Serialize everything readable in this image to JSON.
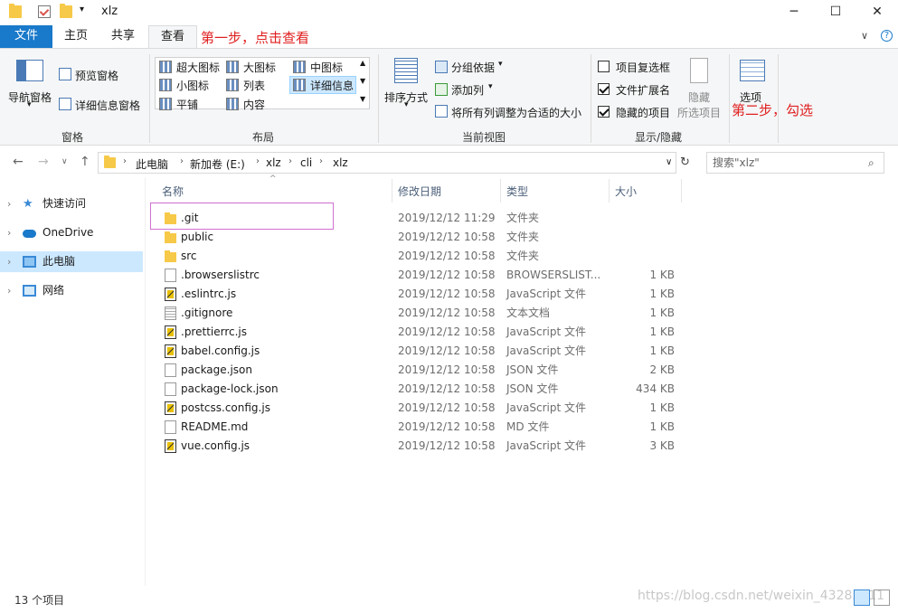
{
  "window": {
    "title": "xlz",
    "minimize": "─",
    "maximize": "☐",
    "close": "✕"
  },
  "tabs": {
    "file": "文件",
    "home": "主页",
    "share": "共享",
    "view": "查看",
    "collapse": "∨",
    "help": "?"
  },
  "annotations": {
    "step1": "第一步，点击查看",
    "step2": "第二步，勾选"
  },
  "ribbon": {
    "panes": {
      "nav_pane": "导航窗格",
      "preview": "预览窗格",
      "details": "详细信息窗格",
      "label": "窗格"
    },
    "layout": {
      "xl_icons": "超大图标",
      "l_icons": "大图标",
      "m_icons": "中图标",
      "s_icons": "小图标",
      "list": "列表",
      "details": "详细信息",
      "tiles": "平铺",
      "content": "内容",
      "label": "布局"
    },
    "view": {
      "sort": "排序方式",
      "group": "分组依据",
      "add_col": "添加列",
      "fit_cols": "将所有列调整为合适的大小",
      "label": "当前视图"
    },
    "showhide": {
      "item_cb": "项目复选框",
      "ext": "文件扩展名",
      "hidden": "隐藏的项目",
      "hide": "隐藏",
      "hide2": "所选项目",
      "label": "显示/隐藏"
    },
    "options": "选项"
  },
  "address": {
    "crumbs": [
      "此电脑",
      "新加卷 (E:)",
      "xlz",
      "cli",
      "xlz"
    ],
    "search_placeholder": "搜索\"xlz\""
  },
  "nav": [
    "快速访问",
    "OneDrive",
    "此电脑",
    "网络"
  ],
  "columns": {
    "name": "名称",
    "date": "修改日期",
    "type": "类型",
    "size": "大小"
  },
  "files": [
    {
      "name": ".git",
      "date": "2019/12/12 11:29",
      "type": "文件夹",
      "size": "",
      "icon": "folder"
    },
    {
      "name": "public",
      "date": "2019/12/12 10:58",
      "type": "文件夹",
      "size": "",
      "icon": "folder"
    },
    {
      "name": "src",
      "date": "2019/12/12 10:58",
      "type": "文件夹",
      "size": "",
      "icon": "folder"
    },
    {
      "name": ".browserslistrc",
      "date": "2019/12/12 10:58",
      "type": "BROWSERSLIST...",
      "size": "1 KB",
      "icon": "doc"
    },
    {
      "name": ".eslintrc.js",
      "date": "2019/12/12 10:58",
      "type": "JavaScript 文件",
      "size": "1 KB",
      "icon": "js"
    },
    {
      "name": ".gitignore",
      "date": "2019/12/12 10:58",
      "type": "文本文档",
      "size": "1 KB",
      "icon": "txt"
    },
    {
      "name": ".prettierrc.js",
      "date": "2019/12/12 10:58",
      "type": "JavaScript 文件",
      "size": "1 KB",
      "icon": "js"
    },
    {
      "name": "babel.config.js",
      "date": "2019/12/12 10:58",
      "type": "JavaScript 文件",
      "size": "1 KB",
      "icon": "js"
    },
    {
      "name": "package.json",
      "date": "2019/12/12 10:58",
      "type": "JSON 文件",
      "size": "2 KB",
      "icon": "doc"
    },
    {
      "name": "package-lock.json",
      "date": "2019/12/12 10:58",
      "type": "JSON 文件",
      "size": "434 KB",
      "icon": "doc"
    },
    {
      "name": "postcss.config.js",
      "date": "2019/12/12 10:58",
      "type": "JavaScript 文件",
      "size": "1 KB",
      "icon": "js"
    },
    {
      "name": "README.md",
      "date": "2019/12/12 10:58",
      "type": "MD 文件",
      "size": "1 KB",
      "icon": "doc"
    },
    {
      "name": "vue.config.js",
      "date": "2019/12/12 10:58",
      "type": "JavaScript 文件",
      "size": "3 KB",
      "icon": "js"
    }
  ],
  "status": "13 个项目",
  "watermark": "https://blog.csdn.net/weixin_43285311",
  "colors": {
    "accent": "#1979ca",
    "annotation": "#e02020",
    "selection": "#cce8ff"
  }
}
